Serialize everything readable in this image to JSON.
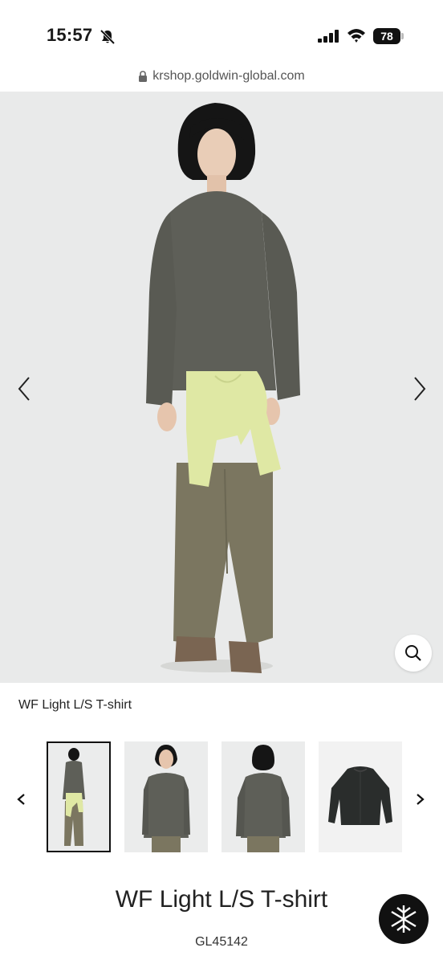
{
  "status_bar": {
    "time": "15:57",
    "battery": "78",
    "icons": [
      "bell-slash-icon",
      "signal-icon",
      "wifi-icon",
      "battery-icon"
    ]
  },
  "browser": {
    "url": "krshop.goldwin-global.com",
    "lock_icon": "lock-icon"
  },
  "gallery": {
    "prev_icon": "chevron-left-icon",
    "next_icon": "chevron-right-icon",
    "zoom_icon": "magnifier-icon",
    "caption": "WF Light L/S T-shirt",
    "thumbnails": [
      {
        "name": "thumb-model-full",
        "active": true
      },
      {
        "name": "thumb-model-front"
      },
      {
        "name": "thumb-model-back"
      },
      {
        "name": "thumb-flatlay"
      }
    ]
  },
  "product": {
    "title": "WF Light L/S T-shirt",
    "code": "GL45142"
  },
  "colors": {
    "sweater": "#5e5f58",
    "pants": "#7b7660",
    "tied_shirt": "#dfe8a4",
    "hero_bg": "#e9eaea",
    "flatlay": "#2a2d2c"
  }
}
